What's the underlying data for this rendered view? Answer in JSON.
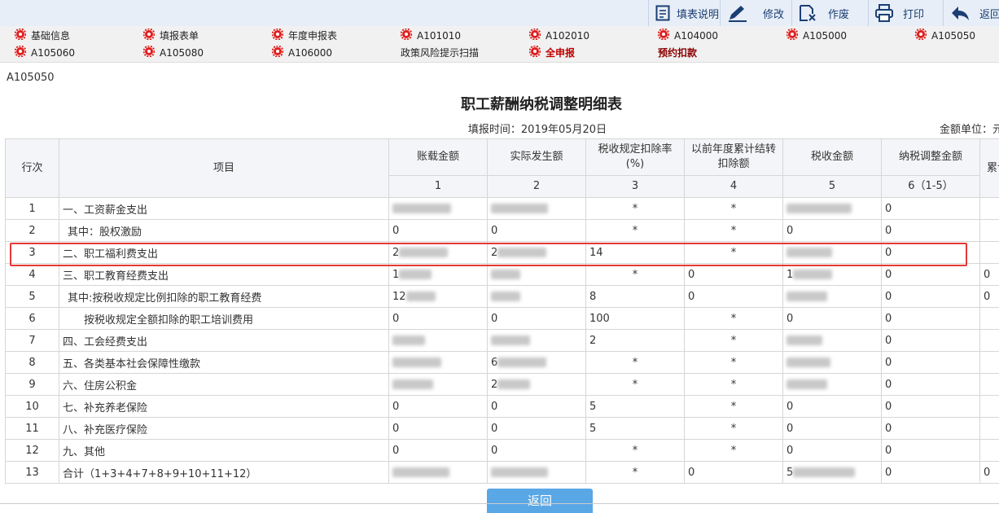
{
  "toolbar": {
    "buttons": [
      {
        "label": "填表说明",
        "icon": "document-icon"
      },
      {
        "label": "修改",
        "icon": "pencil-icon"
      },
      {
        "label": "作废",
        "icon": "void-doc-icon"
      },
      {
        "label": "打印",
        "icon": "printer-icon"
      },
      {
        "label": "返回",
        "icon": "back-arrow-icon"
      }
    ]
  },
  "nav": {
    "row1": [
      "基础信息",
      "填报表单",
      "年度申报表",
      "A101010",
      "A102010",
      "A104000",
      "A105000",
      "A105050"
    ],
    "row2": [
      "A105060",
      "A105080",
      "A106000",
      "政策风险提示扫描",
      "全申报",
      "预约扣款"
    ]
  },
  "form_code": "A105050",
  "title": "职工薪酬纳税调整明细表",
  "fill_date": "填报时间：2019年05月20日",
  "unit_label": "金额单位：元",
  "table": {
    "headers": {
      "row_no": "行次",
      "item": "项目",
      "c1": "账载金额",
      "c2": "实际发生额",
      "c3": "税收规定扣除率(%)",
      "c4": "以前年度累计结转扣除额",
      "c5": "税收金额",
      "c6": "纳税调整金额",
      "c7": "累计"
    },
    "col_numbers": [
      "1",
      "2",
      "3",
      "4",
      "5",
      "6（1-5）"
    ],
    "rows": [
      {
        "no": "1",
        "item": "一、工资薪金支出",
        "c1": "",
        "c2": "",
        "c3": "*",
        "c4": "*",
        "c5": "",
        "c6": "0",
        "c7": ""
      },
      {
        "no": "2",
        "item": "其中：股权激励",
        "c1": "0",
        "c2": "0",
        "c3": "*",
        "c4": "*",
        "c5": "0",
        "c6": "0",
        "c7": ""
      },
      {
        "no": "3",
        "item": "二、职工福利费支出",
        "c1": "2",
        "c2": "2",
        "c3": "14",
        "c4": "*",
        "c5": "",
        "c6": "0",
        "c7": ""
      },
      {
        "no": "4",
        "item": "三、职工教育经费支出",
        "c1": "1",
        "c2": "",
        "c3": "*",
        "c4": "0",
        "c5": "1",
        "c6": "0",
        "c7": "0"
      },
      {
        "no": "5",
        "item": "其中:按税收规定比例扣除的职工教育经费",
        "c1": "12",
        "c2": "",
        "c3": "8",
        "c4": "0",
        "c5": "",
        "c6": "0",
        "c7": "0"
      },
      {
        "no": "6",
        "item": "按税收规定全额扣除的职工培训费用",
        "c1": "0",
        "c2": "0",
        "c3": "100",
        "c4": "*",
        "c5": "0",
        "c6": "0",
        "c7": ""
      },
      {
        "no": "7",
        "item": "四、工会经费支出",
        "c1": "",
        "c2": "",
        "c3": "2",
        "c4": "*",
        "c5": "",
        "c6": "0",
        "c7": ""
      },
      {
        "no": "8",
        "item": "五、各类基本社会保障性缴款",
        "c1": "",
        "c2": "6",
        "c3": "*",
        "c4": "*",
        "c5": "",
        "c6": "0",
        "c7": ""
      },
      {
        "no": "9",
        "item": "六、住房公积金",
        "c1": "",
        "c2": "2",
        "c3": "*",
        "c4": "*",
        "c5": "",
        "c6": "0",
        "c7": ""
      },
      {
        "no": "10",
        "item": "七、补充养老保险",
        "c1": "0",
        "c2": "0",
        "c3": "5",
        "c4": "*",
        "c5": "0",
        "c6": "0",
        "c7": ""
      },
      {
        "no": "11",
        "item": "八、补充医疗保险",
        "c1": "0",
        "c2": "0",
        "c3": "5",
        "c4": "*",
        "c5": "0",
        "c6": "0",
        "c7": ""
      },
      {
        "no": "12",
        "item": "九、其他",
        "c1": "0",
        "c2": "0",
        "c3": "*",
        "c4": "*",
        "c5": "0",
        "c6": "0",
        "c7": ""
      },
      {
        "no": "13",
        "item": "合计（1+3+4+7+8+9+10+11+12）",
        "c1": "",
        "c2": "",
        "c3": "*",
        "c4": "0",
        "c5": "5",
        "c6": "0",
        "c7": "0"
      }
    ]
  },
  "return_button": "返回",
  "colors": {
    "toolbar_bg": "#e8eef7",
    "gear_red": "#e02020",
    "highlight_border": "#e53935",
    "return_button_bg": "#5aa7e6"
  }
}
